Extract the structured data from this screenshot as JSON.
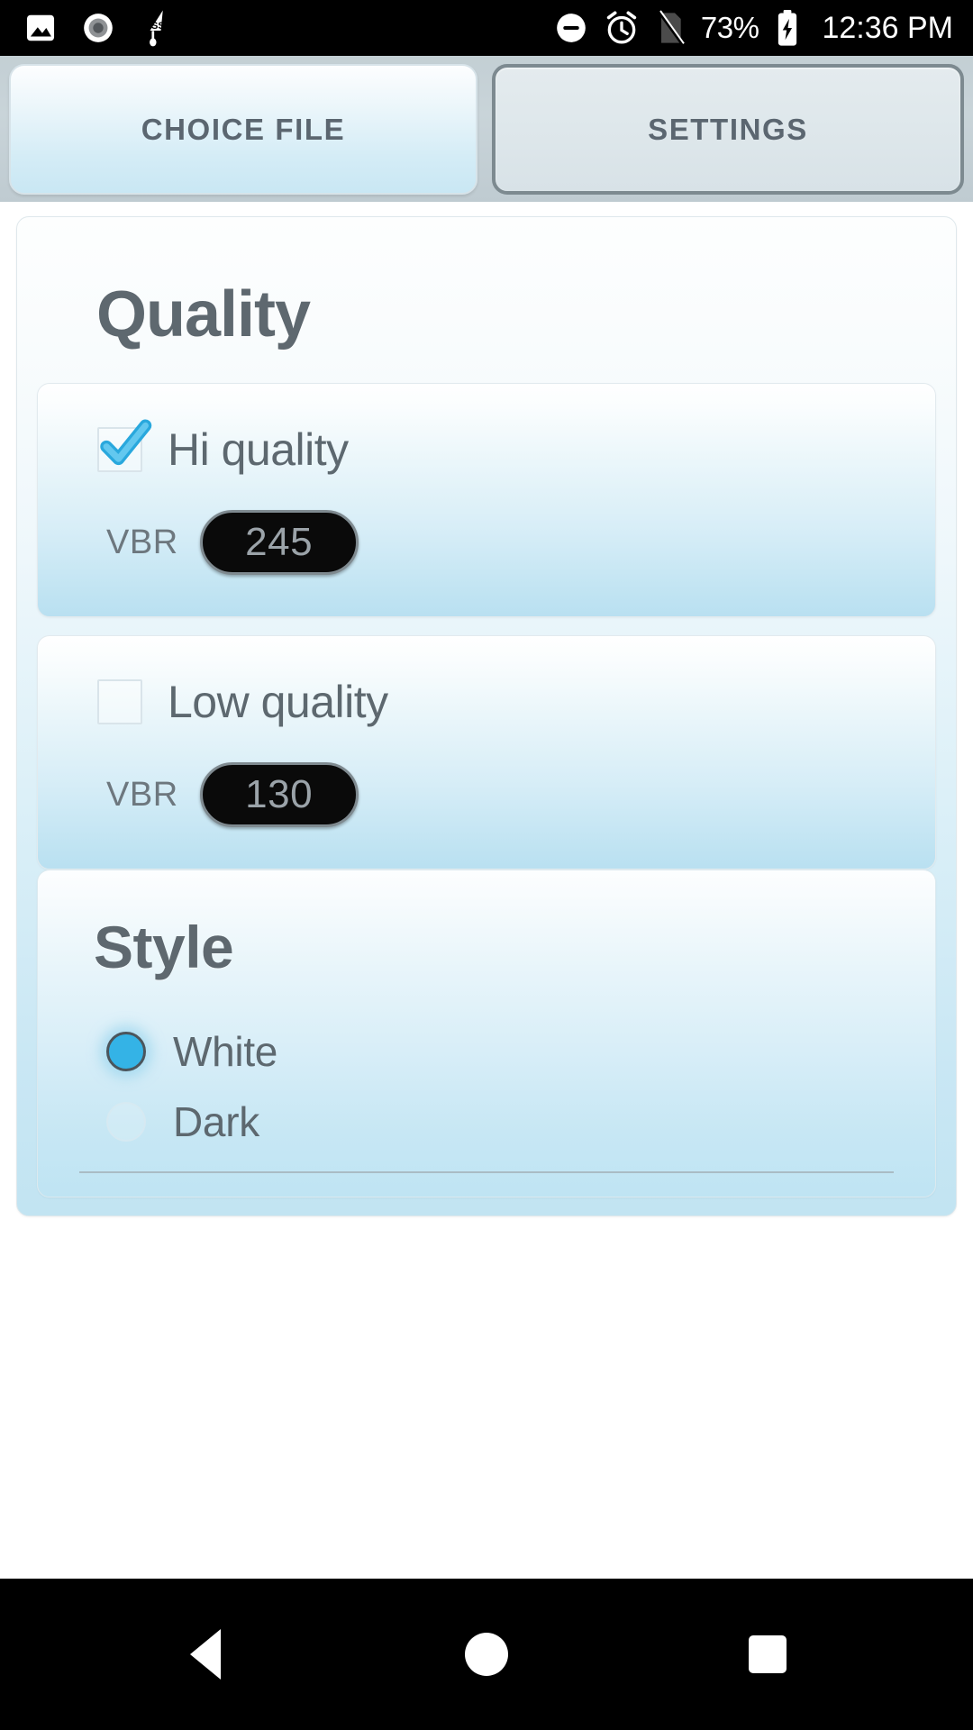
{
  "statusbar": {
    "left_icons": [
      {
        "name": "image-icon"
      },
      {
        "name": "record-icon"
      },
      {
        "name": "ssh-icon",
        "label": "SSH"
      }
    ],
    "right_icons": [
      {
        "name": "do-not-disturb-icon"
      },
      {
        "name": "alarm-icon"
      },
      {
        "name": "no-sim-icon"
      }
    ],
    "battery_percent": "73%",
    "battery_icon": "battery-charging-icon",
    "clock": "12:36 PM"
  },
  "tabs": [
    {
      "label": "CHOICE FILE",
      "selected": false
    },
    {
      "label": "SETTINGS",
      "selected": true
    }
  ],
  "quality": {
    "title": "Quality",
    "options": [
      {
        "label": "Hi quality",
        "checked": true,
        "vbr_label": "VBR",
        "vbr_value": "245"
      },
      {
        "label": "Low quality",
        "checked": false,
        "vbr_label": "VBR",
        "vbr_value": "130"
      }
    ]
  },
  "style": {
    "title": "Style",
    "options": [
      {
        "label": "White",
        "selected": true
      },
      {
        "label": "Dark",
        "selected": false
      }
    ]
  },
  "navbar": {
    "back": "back-button",
    "home": "home-button",
    "recent": "recent-apps-button"
  },
  "colors": {
    "accent": "#34b3e6",
    "text": "#5d686f",
    "statusbar_bg": "#000000",
    "tabbar_bg": "#c9d4d9",
    "card_bottom": "#c2e4f2"
  }
}
